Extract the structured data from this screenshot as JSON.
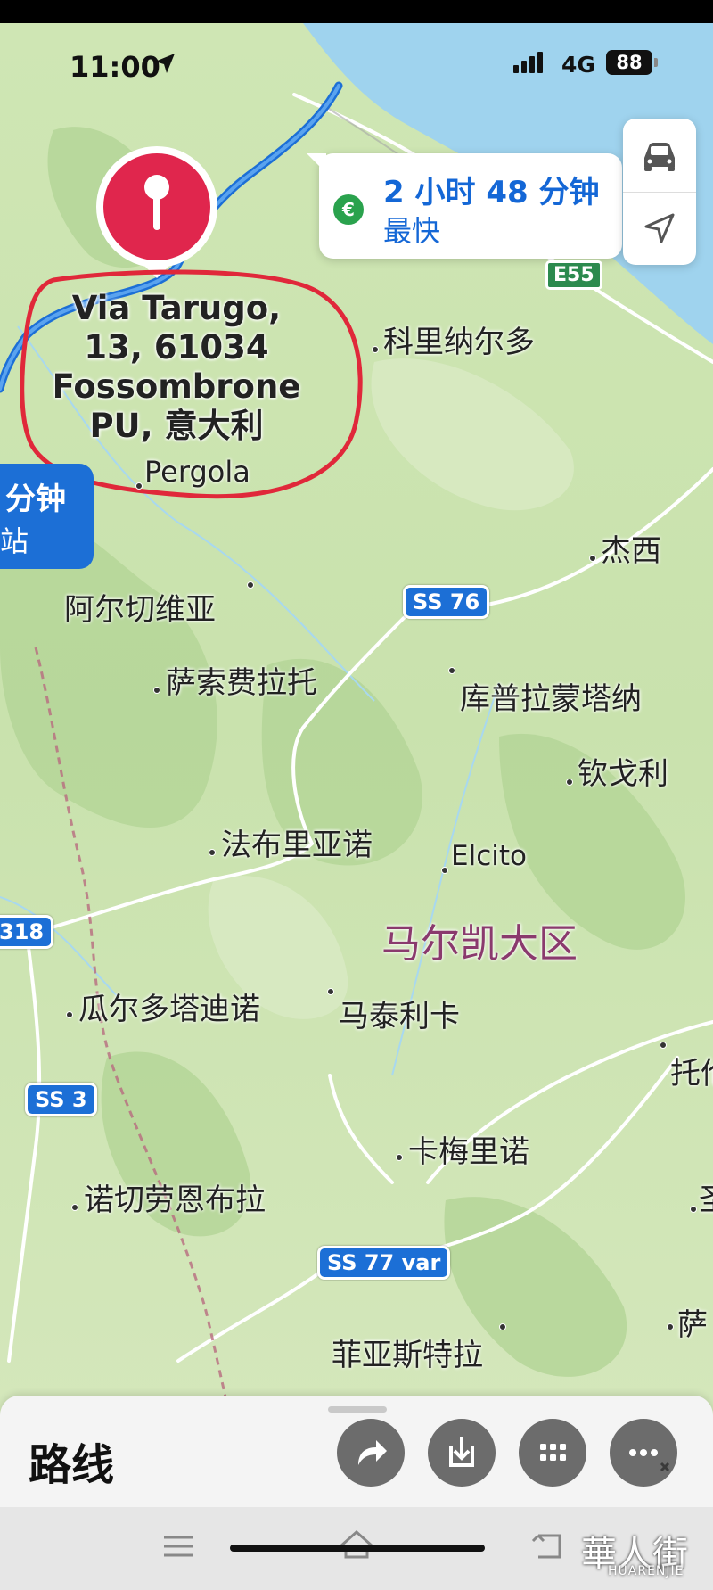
{
  "status_bar": {
    "time": "11:00",
    "network": "4G",
    "battery": "88"
  },
  "route_card": {
    "duration": "2 小时 48 分钟",
    "subtitle": "最快",
    "currency_symbol": "€"
  },
  "pin_address": {
    "line1": "Via Tarugo,",
    "line2": "13, 61034",
    "line3": "Fossombrone",
    "line4": "PU, 意大利"
  },
  "alt_route_pill": {
    "line1": "分钟",
    "line2": "站"
  },
  "places": [
    {
      "key": "pergola",
      "name": "Pergola"
    },
    {
      "key": "koli",
      "name": "科里纳尔多"
    },
    {
      "key": "jesi",
      "name": "杰西"
    },
    {
      "key": "arcevia",
      "name": "阿尔切维亚"
    },
    {
      "key": "sassoferrato",
      "name": "萨索费拉托"
    },
    {
      "key": "cupramontana",
      "name": "库普拉蒙塔纳"
    },
    {
      "key": "cingoli",
      "name": "钦戈利"
    },
    {
      "key": "fabriano",
      "name": "法布里亚诺"
    },
    {
      "key": "elcito",
      "name": "Elcito"
    },
    {
      "key": "gualdo",
      "name": "瓜尔多塔迪诺"
    },
    {
      "key": "matelica",
      "name": "马泰利卡"
    },
    {
      "key": "tolentino",
      "name": "托伦"
    },
    {
      "key": "camerino",
      "name": "卡梅里诺"
    },
    {
      "key": "nocera",
      "name": "诺切劳恩布拉"
    },
    {
      "key": "fiastra",
      "name": "菲亚斯特拉"
    },
    {
      "key": "sarnano",
      "name": "萨"
    },
    {
      "key": "sanseverino",
      "name": "圣"
    }
  ],
  "region_label": "马尔凯大区",
  "road_shields": {
    "e55": "E55",
    "ss76": "SS 76",
    "r318": "318",
    "ss3": "SS 3",
    "ss77": "SS 77 var"
  },
  "bottom_sheet": {
    "title": "路线"
  },
  "watermark": {
    "main": "華人街",
    "sub": "HUARENJIE"
  },
  "colors": {
    "accent_blue": "#1c6fd6",
    "pin_red": "#e0264d",
    "annotation_circle": "#e0283a",
    "euro_green": "#2aa24d"
  },
  "icons": [
    "location-arrow-icon",
    "car-icon",
    "navigation-arrow-icon",
    "euro-icon",
    "share-icon",
    "download-icon",
    "grid-icon",
    "more-icon",
    "menu-icon",
    "home-icon",
    "back-icon"
  ]
}
